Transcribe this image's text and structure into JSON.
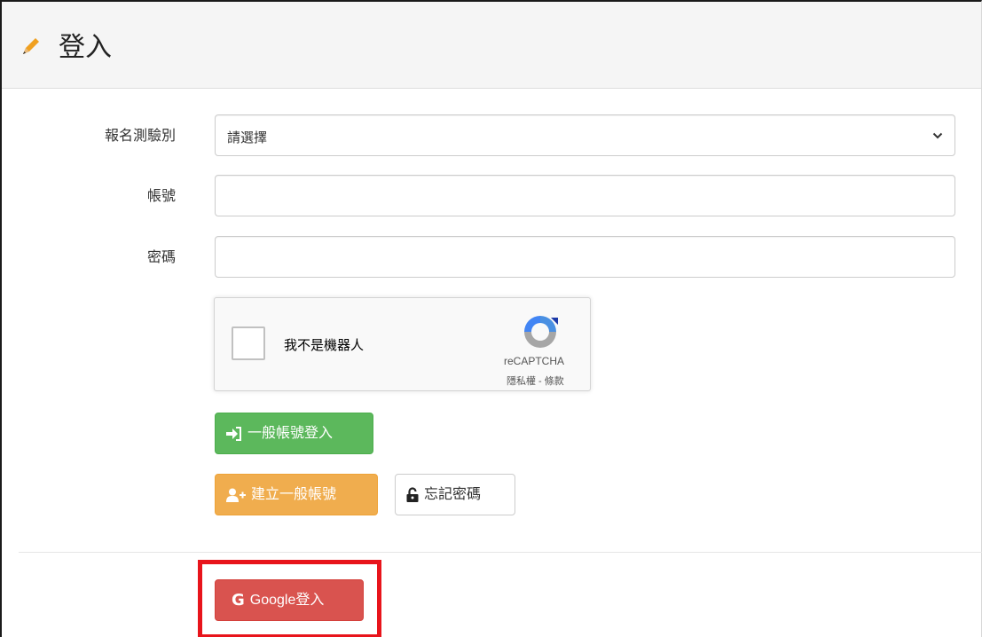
{
  "header": {
    "title": "登入",
    "icon": "pencil-icon"
  },
  "form": {
    "test_type": {
      "label": "報名測驗別",
      "selected": "請選擇"
    },
    "account": {
      "label": "帳號",
      "value": ""
    },
    "password": {
      "label": "密碼",
      "value": ""
    }
  },
  "recaptcha": {
    "checkbox_label": "我不是機器人",
    "brand": "reCAPTCHA",
    "links": "隱私權 - 條款"
  },
  "buttons": {
    "general_login": "一般帳號登入",
    "create_account": "建立一般帳號",
    "forgot_password": "忘記密碼",
    "google_letter": "G",
    "google_login": "Google登入"
  },
  "colors": {
    "success": "#5cb85c",
    "warning": "#f0ad4e",
    "danger": "#d9534f",
    "highlight": "#e8141b",
    "pencil": "#f0a020"
  }
}
